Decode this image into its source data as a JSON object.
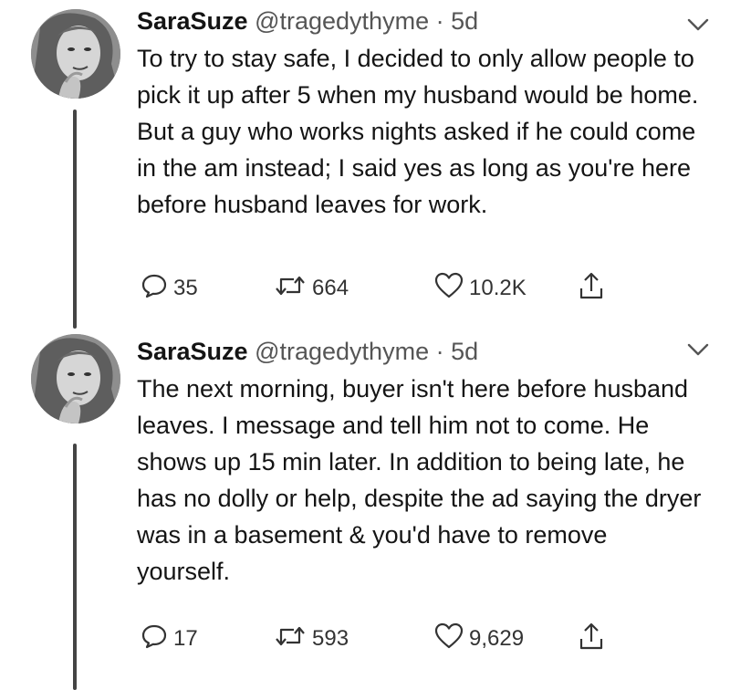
{
  "tweets": [
    {
      "display_name": "SaraSuze",
      "handle": "@tragedythyme",
      "separator": "·",
      "time": "5d",
      "text": "To try to stay safe, I decided to only allow people to pick it up after 5 when my husband would be home. But a guy who works nights asked if he could come in the am instead; I said yes as long as you're here before husband leaves for work.",
      "replies": "35",
      "retweets": "664",
      "likes": "10.2K"
    },
    {
      "display_name": "SaraSuze",
      "handle": "@tragedythyme",
      "separator": "·",
      "time": "5d",
      "text": "The next morning, buyer isn't here before husband leaves. I message and tell him not to come. He shows up 15 min later. In addition to being late, he has no dolly or help, despite the ad saying the dryer was in a basement & you'd have to remove yourself.",
      "replies": "17",
      "retweets": "593",
      "likes": "9,629"
    }
  ],
  "icons": {
    "reply": "reply-icon",
    "retweet": "retweet-icon",
    "like": "heart-icon",
    "share": "share-icon",
    "menu": "chevron-down-icon"
  },
  "colors": {
    "text": "#141414",
    "secondary": "#555555",
    "thread_line": "#444444",
    "background": "#ffffff"
  }
}
